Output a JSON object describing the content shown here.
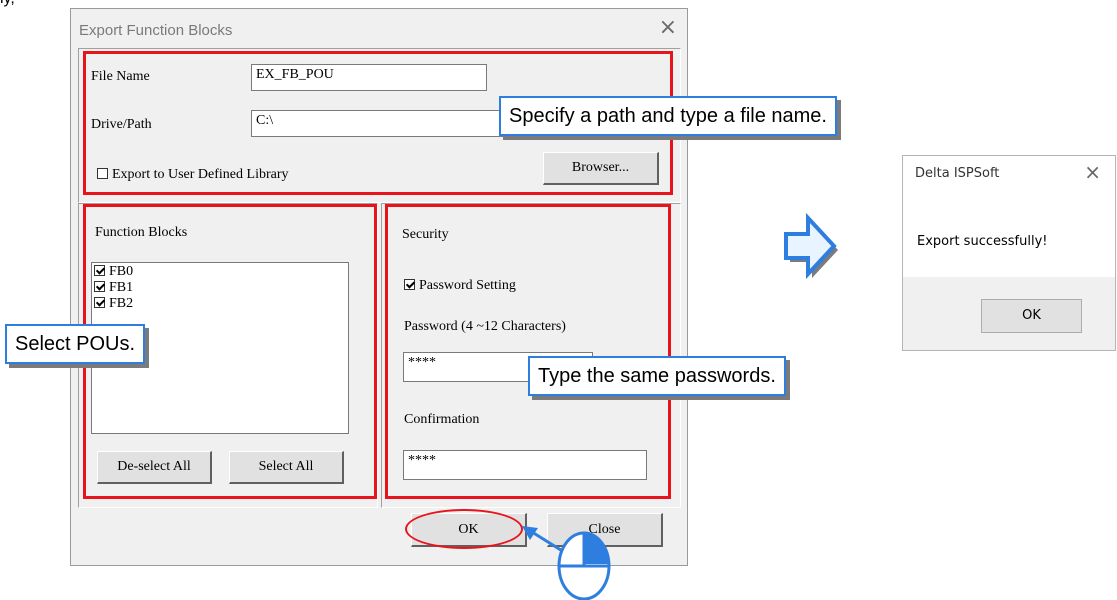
{
  "page_fragment": "ly,",
  "export_dialog": {
    "title": "Export Function Blocks",
    "close_glyph": "×",
    "file_name_label": "File Name",
    "file_name_value": "EX_FB_POU",
    "drive_path_label": "Drive/Path",
    "drive_path_value": "C:\\",
    "export_library_label": "Export to User Defined Library",
    "export_library_checked": false,
    "browser_button": "Browser...",
    "function_blocks_label": "Function Blocks",
    "function_blocks": [
      {
        "name": "FB0",
        "checked": true
      },
      {
        "name": "FB1",
        "checked": true
      },
      {
        "name": "FB2",
        "checked": true
      }
    ],
    "deselect_all_button": "De-select All",
    "select_all_button": "Select All",
    "security_label": "Security",
    "password_setting_label": "Password Setting",
    "password_setting_checked": true,
    "password_label": "Password (4 ~12 Characters)",
    "password_value": "****",
    "confirmation_label": "Confirmation",
    "confirmation_value": "****",
    "ok_button": "OK",
    "close_button": "Close"
  },
  "callouts": {
    "path": "Specify a path and type a file name.",
    "pous": "Select POUs.",
    "passwords": "Type the same passwords."
  },
  "result_dialog": {
    "title": "Delta ISPSoft",
    "close_glyph": "×",
    "message": "Export successfully!",
    "ok_button": "OK"
  },
  "colors": {
    "highlight_red": "#e8141b",
    "callout_blue": "#2e7ee0",
    "arrow_fill": "#e8f4ff"
  },
  "icons": [
    "arrow-right-icon",
    "mouse-click-icon",
    "checkbox-icon"
  ]
}
